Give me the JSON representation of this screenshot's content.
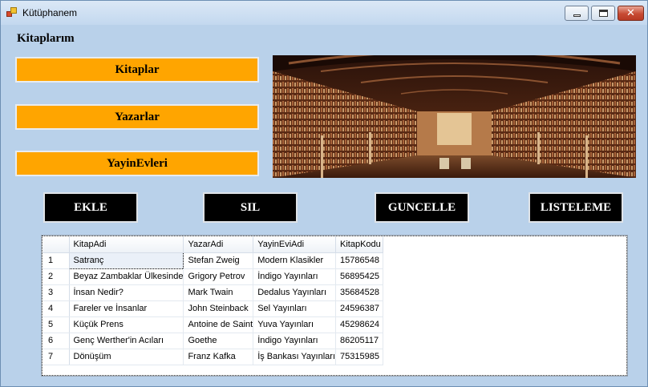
{
  "window": {
    "title": "Kütüphanem",
    "icon": "app-books-icon"
  },
  "heading": "Kitaplarım",
  "menu": {
    "kitaplar": "Kitaplar",
    "yazarlar": "Yazarlar",
    "yayinevleri": "YayinEvleri"
  },
  "actions": {
    "ekle": "EKLE",
    "sil": "SIL",
    "guncelle": "GUNCELLE",
    "listeleme": "LISTELEME"
  },
  "colors": {
    "menu_bg": "#FFA500",
    "action_bg": "#000000",
    "form_bg": "#B9D1EA"
  },
  "grid": {
    "columns": [
      "KitapAdi",
      "YazarAdi",
      "YayinEviAdi",
      "KitapKodu"
    ],
    "rows": [
      {
        "n": "1",
        "cells": [
          "Satranç",
          "Stefan Zweig",
          "Modern Klasikler",
          "15786548"
        ]
      },
      {
        "n": "2",
        "cells": [
          "Beyaz Zambaklar Ülkesinde",
          "Grigory Petrov",
          "İndigo Yayınları",
          "56895425"
        ]
      },
      {
        "n": "3",
        "cells": [
          "İnsan Nedir?",
          "Mark Twain",
          "Dedalus Yayınları",
          "35684528"
        ]
      },
      {
        "n": "4",
        "cells": [
          "Fareler ve İnsanlar",
          "John Steinback",
          "Sel Yayınları",
          "24596387"
        ]
      },
      {
        "n": "5",
        "cells": [
          "Küçük Prens",
          "Antoine de Saint",
          "Yuva Yayınları",
          "45298624"
        ]
      },
      {
        "n": "6",
        "cells": [
          "Genç Werther'in Acıları",
          "Goethe",
          "İndigo Yayınları",
          "86205117"
        ]
      },
      {
        "n": "7",
        "cells": [
          "Dönüşüm",
          "Franz Kafka",
          "İş Bankası Yayınları",
          "75315985"
        ]
      }
    ]
  }
}
